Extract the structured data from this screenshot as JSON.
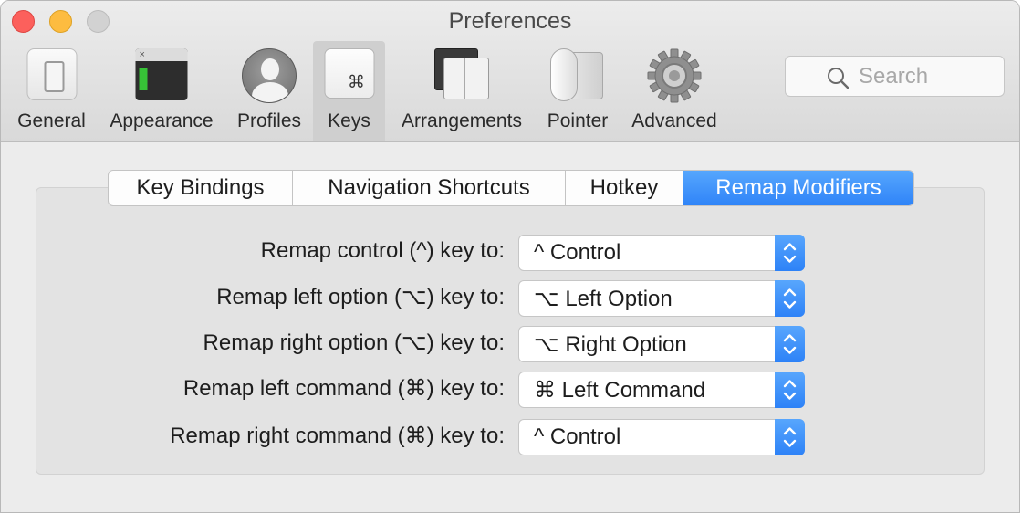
{
  "window": {
    "title": "Preferences"
  },
  "toolbar": {
    "items": [
      {
        "label": "General",
        "icon": "general-icon"
      },
      {
        "label": "Appearance",
        "icon": "appearance-icon"
      },
      {
        "label": "Profiles",
        "icon": "profiles-icon"
      },
      {
        "label": "Keys",
        "icon": "keys-icon",
        "active": true
      },
      {
        "label": "Arrangements",
        "icon": "arrangements-icon"
      },
      {
        "label": "Pointer",
        "icon": "pointer-icon"
      },
      {
        "label": "Advanced",
        "icon": "gear-icon"
      }
    ],
    "keys_glyph": "⌘",
    "appearance_glyph": "×"
  },
  "search": {
    "placeholder": "Search",
    "icon": "search-icon"
  },
  "tabs": [
    {
      "label": "Key Bindings"
    },
    {
      "label": "Navigation Shortcuts"
    },
    {
      "label": "Hotkey"
    },
    {
      "label": "Remap Modifiers",
      "selected": true
    }
  ],
  "remap": [
    {
      "label": "Remap control (^) key to:",
      "value": "^ Control"
    },
    {
      "label": "Remap left option (⌥) key to:",
      "value": "⌥ Left Option"
    },
    {
      "label": "Remap right option (⌥) key to:",
      "value": "⌥ Right Option"
    },
    {
      "label": "Remap left command (⌘) key to:",
      "value": "⌘ Left Command"
    },
    {
      "label": "Remap right command (⌘) key to:",
      "value": "^ Control"
    }
  ],
  "colors": {
    "accent": "#2f84f8",
    "close": "#fc605c",
    "minimize": "#fdbc40",
    "zoom": "#d2d2d2",
    "terminal_cursor": "#37c337"
  }
}
